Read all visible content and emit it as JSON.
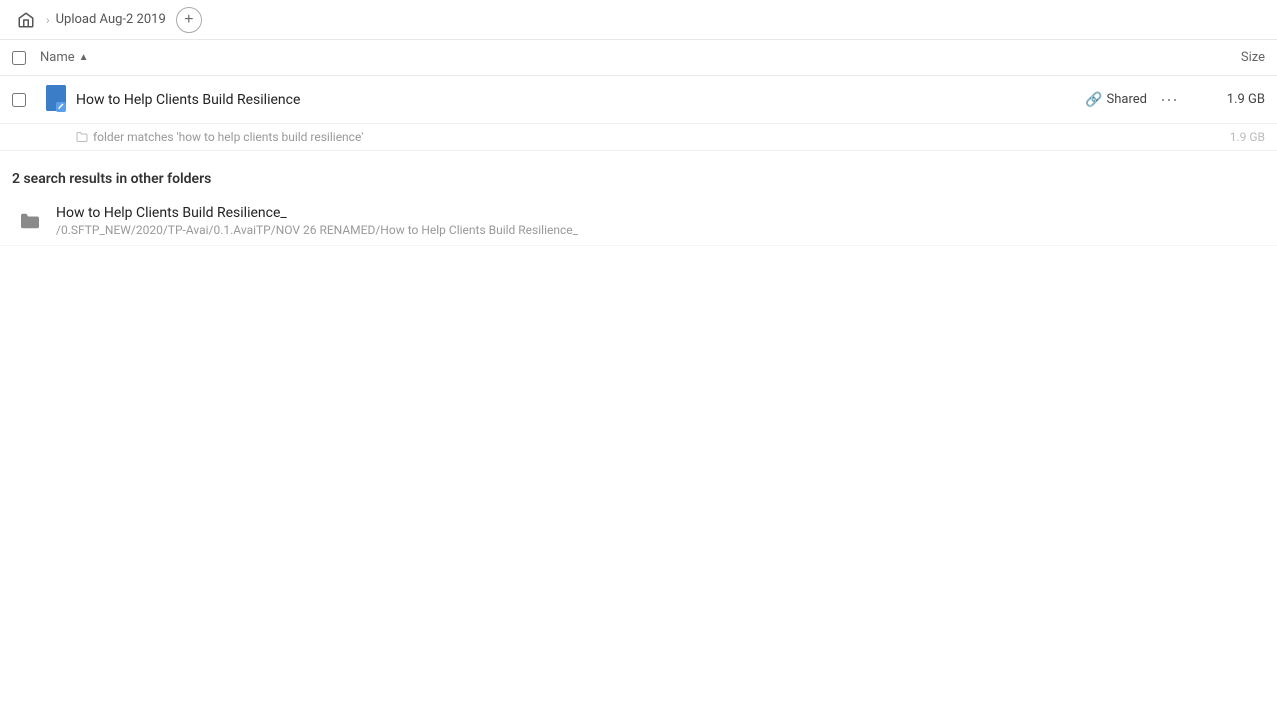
{
  "header": {
    "home_label": "Home",
    "breadcrumb_label": "Upload Aug-2 2019",
    "add_button_label": "+"
  },
  "columns": {
    "name_label": "Name",
    "size_label": "Size"
  },
  "main_result": {
    "name": "How to Help Clients Build Resilience",
    "shared_label": "Shared",
    "size": "1.9 GB"
  },
  "match_hint": {
    "text": "folder matches 'how to help clients build resilience'",
    "size": "1.9 GB"
  },
  "other_folders_section": {
    "header": "2 search results in other folders"
  },
  "other_results": [
    {
      "name": "How to Help Clients Build Resilience_",
      "path": "/0.SFTP_NEW/2020/TP-Avai/0.1.AvaiTP/NOV 26 RENAMED/How to Help Clients Build Resilience_"
    }
  ]
}
